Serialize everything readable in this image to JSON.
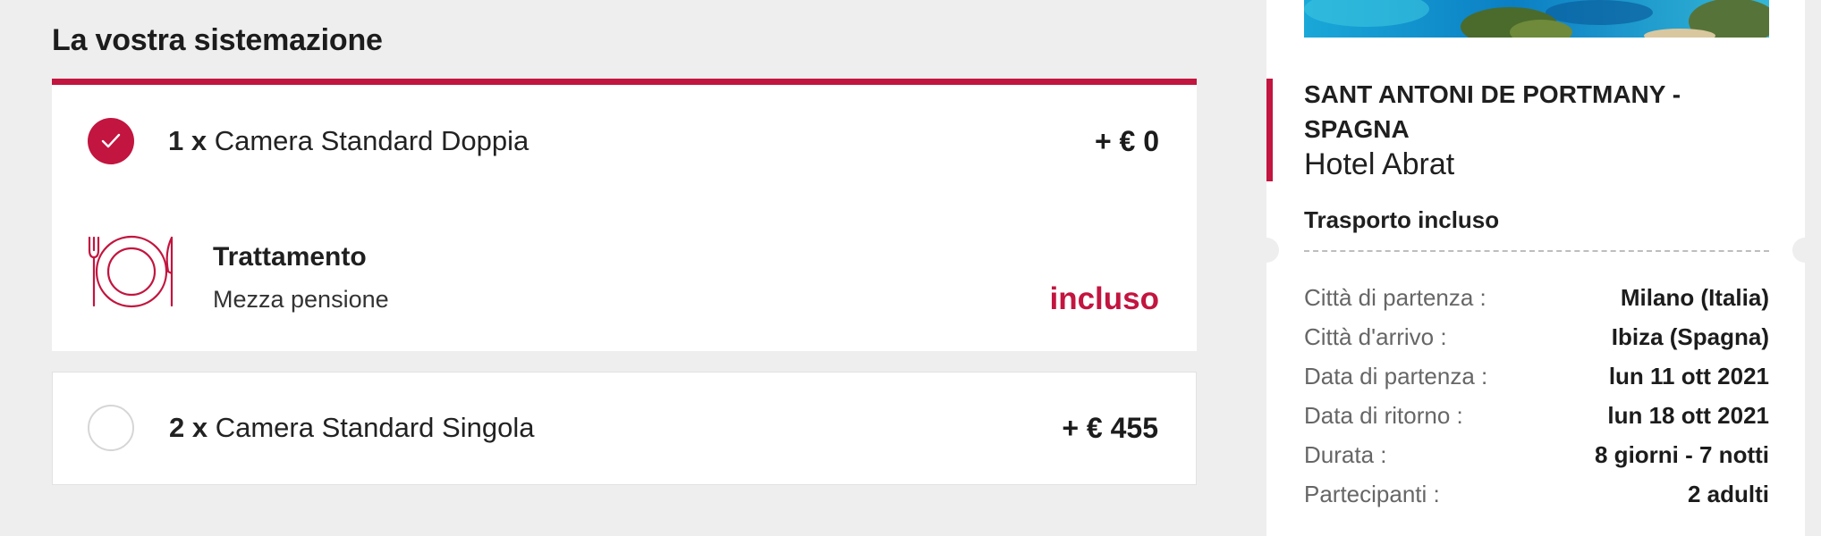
{
  "accommodation": {
    "section_title": "La vostra sistemazione",
    "rooms": [
      {
        "selected": true,
        "quantity": "1 x",
        "name": "Camera Standard Doppia",
        "price": "+ € 0",
        "meal": {
          "title": "Trattamento",
          "plan": "Mezza pensione",
          "status": "incluso"
        }
      },
      {
        "selected": false,
        "quantity": "2 x",
        "name": "Camera Standard Singola",
        "price": "+ € 455"
      }
    ]
  },
  "summary": {
    "destination": "SANT ANTONI DE PORTMANY - SPAGNA",
    "hotel": "Hotel Abrat",
    "transport": "Trasporto incluso",
    "details": [
      {
        "label": "Città di partenza :",
        "value": "Milano (Italia)"
      },
      {
        "label": "Città d'arrivo :",
        "value": "Ibiza (Spagna)"
      },
      {
        "label": "Data di partenza :",
        "value": "lun 11 ott 2021"
      },
      {
        "label": "Data di ritorno :",
        "value": "lun 18 ott 2021"
      },
      {
        "label": "Durata :",
        "value": "8 giorni - 7 notti"
      },
      {
        "label": "Partecipanti :",
        "value": "2 adulti"
      }
    ]
  },
  "colors": {
    "accent": "#c2153f",
    "page_background": "#eeeeee"
  },
  "icons": {
    "check": "check-icon",
    "meal": "plate-cutlery-icon"
  }
}
